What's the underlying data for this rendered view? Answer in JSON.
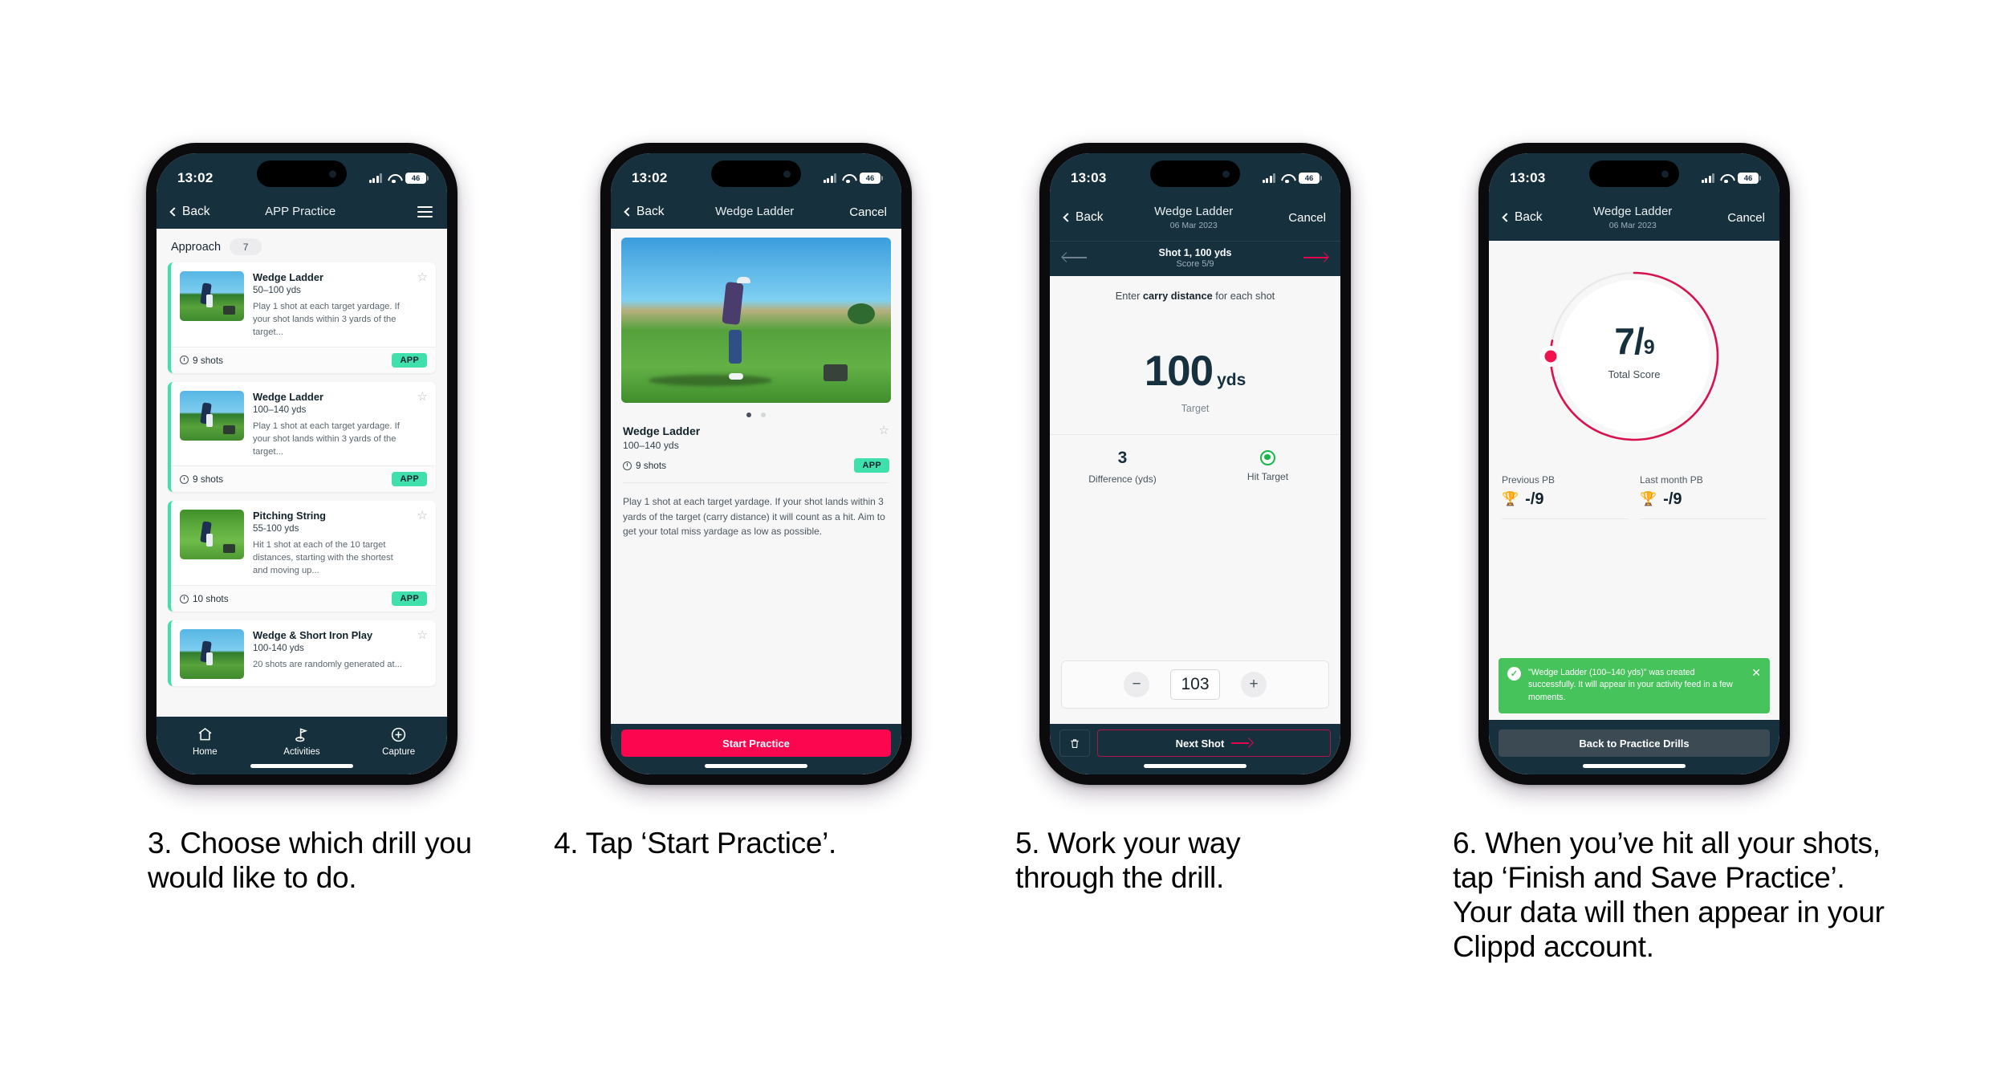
{
  "meta": {
    "accent_pink": "#fb064f",
    "accent_teal": "#3fe0ac",
    "navy": "#16303e",
    "green": "#46c35a"
  },
  "phone1": {
    "status": {
      "time": "13:02",
      "battery": "46"
    },
    "nav": {
      "back": "Back",
      "title": "APP Practice",
      "menu_icon": "hamburger-icon"
    },
    "section": {
      "label": "Approach",
      "count": "7"
    },
    "cards": [
      {
        "title": "Wedge Ladder",
        "sub": "50–100 yds",
        "desc": "Play 1 shot at each target yardage. If your shot lands within 3 yards of the target...",
        "shots": "9 shots",
        "badge": "APP"
      },
      {
        "title": "Wedge Ladder",
        "sub": "100–140 yds",
        "desc": "Play 1 shot at each target yardage. If your shot lands within 3 yards of the target...",
        "shots": "9 shots",
        "badge": "APP"
      },
      {
        "title": "Pitching String",
        "sub": "55-100 yds",
        "desc": "Hit 1 shot at each of the 10 target distances, starting with the shortest and moving up...",
        "shots": "10 shots",
        "badge": "APP"
      },
      {
        "title": "Wedge & Short Iron Play",
        "sub": "100-140 yds",
        "desc": "20 shots are randomly generated at...",
        "shots": "",
        "badge": ""
      }
    ],
    "tabs": [
      {
        "label": "Home",
        "icon": "home-icon"
      },
      {
        "label": "Activities",
        "icon": "golf-flag-icon"
      },
      {
        "label": "Capture",
        "icon": "plus-circle-icon"
      }
    ]
  },
  "phone2": {
    "status": {
      "time": "13:02",
      "battery": "46"
    },
    "nav": {
      "back": "Back",
      "title": "Wedge Ladder",
      "cancel": "Cancel"
    },
    "detail": {
      "title": "Wedge Ladder",
      "sub": "100–140 yds",
      "shots": "9 shots",
      "badge": "APP",
      "desc": "Play 1 shot at each target yardage. If your shot lands within 3 yards of the target (carry distance) it will count as a hit. Aim to get your total miss yardage as low as possible."
    },
    "cta": "Start Practice"
  },
  "phone3": {
    "status": {
      "time": "13:03",
      "battery": "46"
    },
    "nav": {
      "back": "Back",
      "title": "Wedge Ladder",
      "subtitle": "06 Mar 2023",
      "cancel": "Cancel"
    },
    "shotbar": {
      "title": "Shot 1, 100 yds",
      "score": "Score 5/9"
    },
    "hint_pre": "Enter ",
    "hint_bold": "carry distance",
    "hint_post": " for each shot",
    "target": {
      "value": "100",
      "unit": "yds",
      "label": "Target"
    },
    "stats": [
      {
        "value": "3",
        "label": "Difference (yds)"
      },
      {
        "value": "",
        "label": "Hit Target",
        "icon": "target-hit-icon"
      }
    ],
    "stepper": {
      "minus": "−",
      "value": "103",
      "plus": "+"
    },
    "footer": {
      "delete_icon": "trash-icon",
      "next": "Next Shot"
    }
  },
  "phone4": {
    "status": {
      "time": "13:03",
      "battery": "46"
    },
    "nav": {
      "back": "Back",
      "title": "Wedge Ladder",
      "subtitle": "06 Mar 2023",
      "cancel": "Cancel"
    },
    "ring": {
      "score": "7",
      "of": "9",
      "label": "Total Score",
      "percent": 78
    },
    "pbs": [
      {
        "label": "Previous PB",
        "value": "-/9",
        "icon": "trophy-icon"
      },
      {
        "label": "Last month PB",
        "value": "-/9",
        "icon": "trophy-icon"
      }
    ],
    "toast": {
      "text": "\"Wedge Ladder (100–140 yds)\" was created successfully. It will appear in your activity feed in a few moments.",
      "close_icon": "close-icon"
    },
    "button": "Back to Practice Drills"
  },
  "captions": [
    "3. Choose which drill you would like to do.",
    "4. Tap ‘Start Practice’.",
    "5. Work your way through the drill.",
    "6. When you’ve hit all your shots, tap ‘Finish and Save Practice’. Your data will then appear in your Clippd account."
  ]
}
